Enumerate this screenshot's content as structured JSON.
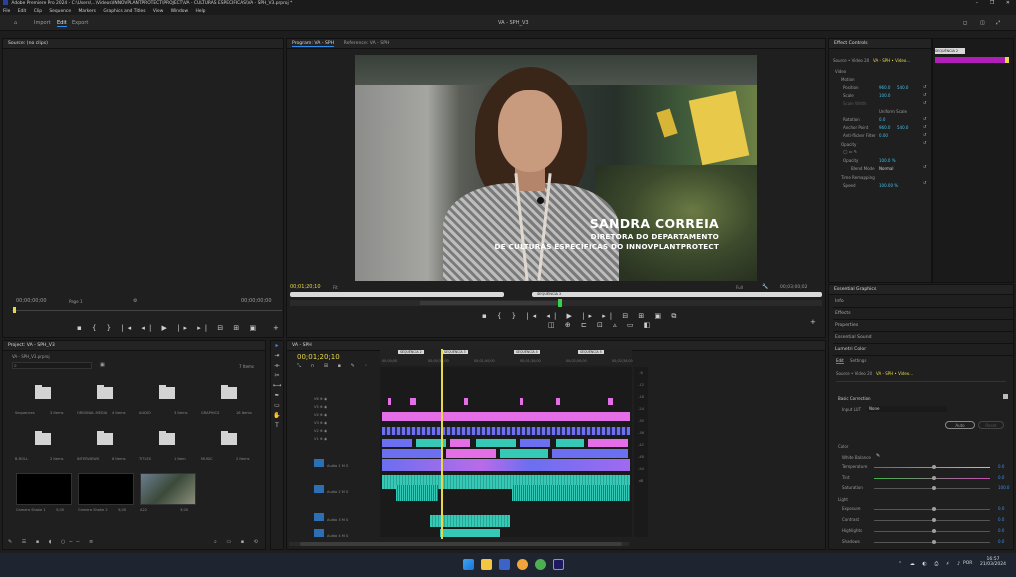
{
  "window": {
    "title": "Adobe Premiere Pro 2024 - C:\\Users\\...\\Videos\\INNOVPLANTPROTECT\\PROJECT\\VA - CULTURAS ESPECIFICAS\\VA - SPH_V3.prproj *",
    "controls": [
      "–",
      "❐",
      "✕"
    ]
  },
  "menu": [
    "File",
    "Edit",
    "Clip",
    "Sequence",
    "Markers",
    "Graphics and Titles",
    "View",
    "Window",
    "Help"
  ],
  "workspace": {
    "tabs": [
      "Import",
      "Edit",
      "Export"
    ],
    "active": "Edit",
    "project_name": "VA - SPH_V3"
  },
  "source_monitor": {
    "tab": "Source: (no clips)",
    "timecode_left": "00;00;00;00",
    "page": "Page 1",
    "timecode_right": "00;00;00;00"
  },
  "program_monitor": {
    "tabs": [
      "Program: VA - SPH",
      "Reference: VA - SPH"
    ],
    "timecode": "00;01;20;10",
    "fit": "Fit",
    "quality": "Full",
    "duration": "00;03;00;02",
    "marker_label": "SEQUÊNCIA 2",
    "lower_third": {
      "name": "SANDRA CORREIA",
      "role_line1": "DIRETORA DO DEPARTAMENTO",
      "role_line2": "DE CULTURAS ESPECÍFICAS DO INNOVPLANTPROTECT"
    }
  },
  "effect_controls": {
    "tab": "Effect Controls",
    "source": "Source • Video 20",
    "sequence": "VA - SPH • Video...",
    "section_video": "Video",
    "motion": "Motion",
    "position_label": "Position",
    "position_x": "960.0",
    "position_y": "540.0",
    "scale_label": "Scale",
    "scale_value": "100.0",
    "scale_width_label": "Scale Width",
    "uniform_scale": "Uniform Scale",
    "rotation_label": "Rotation",
    "rotation_value": "0.0",
    "anchor_label": "Anchor Point",
    "anchor_x": "960.0",
    "anchor_y": "540.0",
    "flicker_label": "Anti-flicker Filter",
    "flicker_value": "0.00",
    "opacity_label": "Opacity",
    "opacity_value": "100.0 %",
    "blend_label": "Blend Mode",
    "blend_value": "Normal",
    "time_remap": "Time Remapping",
    "speed_label": "Speed",
    "speed_value": "100.00 %",
    "clip_label": "SEQUÊNCIA 2"
  },
  "project_panel": {
    "tab": "Project: VA - SPH_V3",
    "path": "VA - SPH_V3.prproj",
    "search_placeholder": "",
    "items_count": "7 Items",
    "folders": [
      {
        "name": "Sequences",
        "count": "3 Items"
      },
      {
        "name": "ORIGINAL MEDIA",
        "count": "4 Items"
      },
      {
        "name": "AUDIO",
        "count": "3 Items"
      },
      {
        "name": "GRAPHICS",
        "count": "16 Items"
      },
      {
        "name": "B-ROLL",
        "count": "2 Items"
      },
      {
        "name": "INTERVIEWS",
        "count": "6 Items"
      },
      {
        "name": "TITLES",
        "count": "1 Item"
      },
      {
        "name": "MUSIC",
        "count": "2 Items"
      }
    ],
    "clips": [
      {
        "name": "Camera Shake 1",
        "dur": "5;00"
      },
      {
        "name": "Camera Shake 2",
        "dur": "5;00"
      },
      {
        "name": "A22",
        "dur": "3;00"
      }
    ]
  },
  "timeline": {
    "tab": "VA - SPH",
    "timecode": "00;01;20;10",
    "ruler": [
      "00;00;00",
      "00;00;30;00",
      "00;01;00;00",
      "00;01;30;00",
      "00;02;00;00",
      "00;02;30;00"
    ],
    "markers": [
      "SEQUÊNCIA 2",
      "SEQUÊNCIA 3",
      "SEQUÊNCIA 4",
      "SEQUÊNCIA 5"
    ],
    "tracks_video": [
      "V6",
      "V5",
      "V4",
      "V3",
      "V2",
      "V1"
    ],
    "tracks_audio": [
      "A1",
      "A2",
      "A3",
      "A4"
    ],
    "audio_labels": [
      "Audio 1",
      "Audio 2",
      "Audio 3",
      "Audio 4"
    ]
  },
  "right_panels": {
    "essential_tab": "Essential Graphics",
    "rows": [
      "Info",
      "Effects",
      "Properties",
      "Essential Sound"
    ],
    "lumetri": {
      "title": "Lumetri Color",
      "tab_edit": "Edit",
      "tab_settings": "Settings",
      "source": "Source • Video 20",
      "sequence": "VA - SPH • Video...",
      "basic_correction": "Basic Correction",
      "input_lut_label": "Input LUT",
      "input_lut_value": "None",
      "auto_button": "Auto",
      "reset_button": "Reset",
      "color_section": "Color",
      "wb_label": "White Balance",
      "sliders": [
        {
          "label": "Temperature",
          "value": "0.0",
          "pos": 0.52
        },
        {
          "label": "Tint",
          "value": "0.0",
          "pos": 0.52
        },
        {
          "label": "Saturation",
          "value": "100.0",
          "pos": 0.52
        },
        {
          "label": "Exposure",
          "value": "0.0",
          "pos": 0.52
        },
        {
          "label": "Contrast",
          "value": "0.0",
          "pos": 0.52
        },
        {
          "label": "Highlights",
          "value": "0.0",
          "pos": 0.52
        },
        {
          "label": "Shadows",
          "value": "0.0",
          "pos": 0.52
        }
      ],
      "light_section": "Light"
    }
  },
  "taskbar": {
    "time": "16:57",
    "date": "21/03/2024",
    "lang": "POR"
  },
  "colors": {
    "accent_blue": "#2d8ceb",
    "clip_pink": "#e36ee6",
    "clip_teal": "#36c9b6",
    "clip_purple": "#6b6ff0",
    "playhead": "#e7d84a"
  }
}
